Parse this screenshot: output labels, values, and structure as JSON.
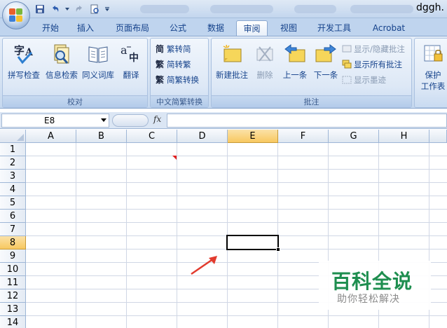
{
  "title": "dggh.",
  "tabs": [
    "开始",
    "插入",
    "页面布局",
    "公式",
    "数据",
    "审阅",
    "视图",
    "开发工具",
    "Acrobat"
  ],
  "active_tab": "审阅",
  "ribbon": {
    "proofing": {
      "label": "校对",
      "spell": "拼写检查",
      "research": "信息检索",
      "thesaurus": "同义词库",
      "translate": "翻译"
    },
    "chinese": {
      "label": "中文简繁转换",
      "to_simplified": "繁转简",
      "to_traditional": "简转繁",
      "convert": "简繁转换"
    },
    "comments": {
      "label": "批注",
      "new": "新建批注",
      "delete": "删除",
      "prev": "上一条",
      "next": "下一条",
      "show_hide": "显示/隐藏批注",
      "show_all": "显示所有批注",
      "show_ink": "显示墨迹"
    },
    "changes": {
      "protect_line1": "保护",
      "protect_line2": "工作表"
    }
  },
  "formula_bar": {
    "namebox": "E8",
    "fx": "fx",
    "value": ""
  },
  "columns": [
    "A",
    "B",
    "C",
    "D",
    "E",
    "F",
    "G",
    "H"
  ],
  "rows": [
    "1",
    "2",
    "3",
    "4",
    "5",
    "6",
    "7",
    "8",
    "9",
    "10",
    "11",
    "12",
    "13",
    "14"
  ],
  "selected_cell": "E8",
  "watermark": {
    "big": "百科全说",
    "small": "助你轻松解决"
  },
  "colors": {
    "accent": "#15428b",
    "selected_header": "#f8c860",
    "comment_mark": "#e02020",
    "arrow": "#e23b2e",
    "watermark_green": "#1e8e4f"
  }
}
